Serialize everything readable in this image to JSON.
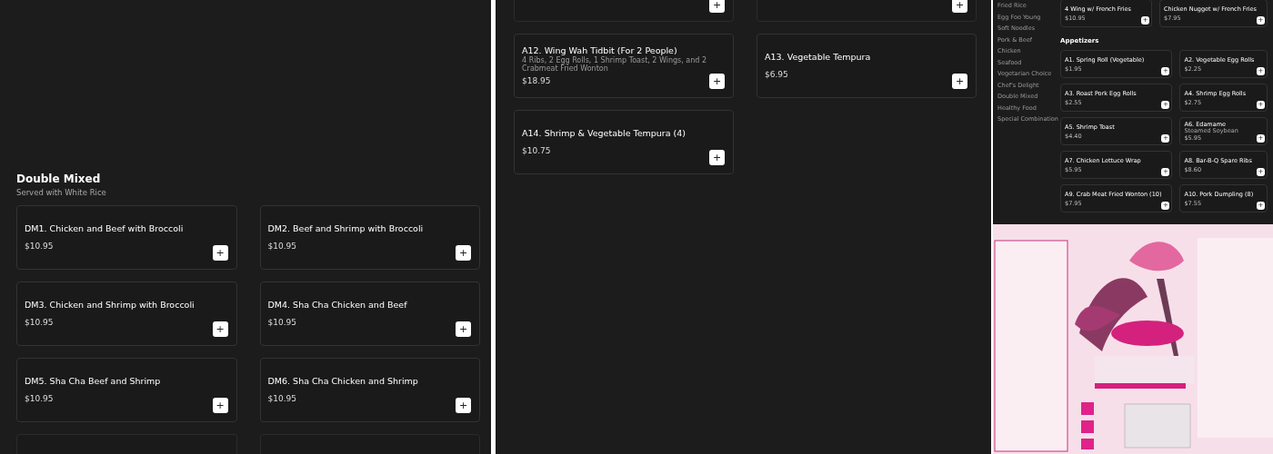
{
  "left": {
    "section": {
      "title": "Double Mixed",
      "subtitle": "Served with White Rice"
    },
    "items": [
      {
        "name": "DM1. Chicken and Beef with Broccoli",
        "price": "$10.95",
        "add": "+"
      },
      {
        "name": "DM2. Beef and Shrimp with Broccoli",
        "price": "$10.95",
        "add": "+"
      },
      {
        "name": "DM3. Chicken and Shrimp with Broccoli",
        "price": "$10.95",
        "add": "+"
      },
      {
        "name": "DM4. Sha Cha Chicken and Beef",
        "price": "$10.95",
        "add": "+"
      },
      {
        "name": "DM5. Sha Cha Beef and Shrimp",
        "price": "$10.95",
        "add": "+"
      },
      {
        "name": "DM6. Sha Cha Chicken and Shrimp",
        "price": "$10.95",
        "add": "+"
      },
      {
        "kind": "cut"
      },
      {
        "kind": "cut"
      }
    ]
  },
  "middle": {
    "items": [
      {
        "kind": "cut",
        "add": "+"
      },
      {
        "kind": "cut",
        "add": "+"
      },
      {
        "name": "A12. Wing Wah Tidbit (For 2 People)",
        "description": "4 Ribs, 2 Egg Rolls, 1 Shrimp Toast, 2 Wings, and 2 Crabmeat Fried Wonton",
        "price": "$18.95",
        "add": "+"
      },
      {
        "name": "A13. Vegetable Tempura",
        "price": "$6.95",
        "add": "+"
      },
      {
        "name": "A14. Shrimp & Vegetable Tempura (4)",
        "price": "$10.75",
        "add": "+"
      }
    ]
  },
  "right": {
    "sidebar": {
      "items": [
        "Fried Rice",
        "Egg Foo Young",
        "Soft Noodles",
        "Pork & Beef",
        "Chicken",
        "Seafood",
        "Vegetarian Choice",
        "Chef's Delight",
        "Double Mixed",
        "Healthy Food",
        "Special Combination"
      ]
    },
    "top_items": [
      {
        "name": "4 Wing w/ French Fries",
        "price": "$10.95",
        "add": "+"
      },
      {
        "name": "Chicken Nugget w/ French Fries",
        "price": "$7.95",
        "add": "+"
      }
    ],
    "section": {
      "title": "Appetizers"
    },
    "items": [
      {
        "name": "A1. Spring Roll (Vegetable)",
        "price": "$1.95",
        "add": "+"
      },
      {
        "name": "A2. Vegetable Egg Rolls",
        "price": "$2.25",
        "add": "+"
      },
      {
        "name": "A3. Roast Pork Egg Rolls",
        "price": "$2.55",
        "add": "+"
      },
      {
        "name": "A4. Shrimp Egg Rolls",
        "price": "$2.75",
        "add": "+"
      },
      {
        "name": "A5. Shrimp Toast",
        "price": "$4.40",
        "add": "+"
      },
      {
        "name": "A6. Edamame",
        "description": "Steamed Soybean",
        "price": "$5.95",
        "add": "+"
      },
      {
        "name": "A7. Chicken Lettuce Wrap",
        "price": "$5.95",
        "add": "+"
      },
      {
        "name": "A8. Bar-B-Q Spare Ribs",
        "price": "$8.60",
        "add": "+"
      },
      {
        "name": "A9. Crab Meat Fried Wonton (10)",
        "price": "$7.95",
        "add": "+"
      },
      {
        "name": "A10. Pork Dumpling (8)",
        "price": "$7.55",
        "add": "+"
      }
    ]
  }
}
